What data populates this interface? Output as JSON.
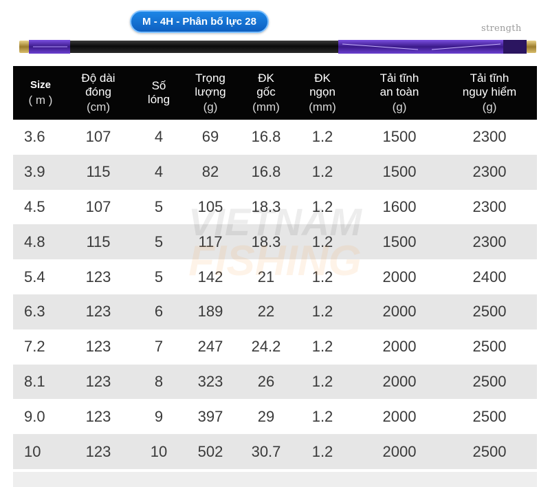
{
  "header": {
    "title": "M - 4H - Phân bố lực 28",
    "strength_label": "strength"
  },
  "table": {
    "columns": [
      {
        "lines": [
          "Size"
        ],
        "unit": "( m )",
        "bold": true
      },
      {
        "lines": [
          "Độ dài",
          "đóng"
        ],
        "unit": "(cm)"
      },
      {
        "lines": [
          "Số",
          "lóng"
        ],
        "unit": ""
      },
      {
        "lines": [
          "Trọng",
          "lượng"
        ],
        "unit": "(g)"
      },
      {
        "lines": [
          "ĐK",
          "gốc"
        ],
        "unit": "(mm)"
      },
      {
        "lines": [
          "ĐK",
          "ngọn"
        ],
        "unit": "(mm)"
      },
      {
        "lines": [
          "Tải tĩnh",
          "an toàn"
        ],
        "unit": "(g)"
      },
      {
        "lines": [
          "Tải tĩnh",
          "nguy hiểm"
        ],
        "unit": "(g)"
      }
    ],
    "rows": [
      [
        "3.6",
        "107",
        "4",
        "69",
        "16.8",
        "1.2",
        "1500",
        "2300"
      ],
      [
        "3.9",
        "115",
        "4",
        "82",
        "16.8",
        "1.2",
        "1500",
        "2300"
      ],
      [
        "4.5",
        "107",
        "5",
        "105",
        "18.3",
        "1.2",
        "1600",
        "2300"
      ],
      [
        "4.8",
        "115",
        "5",
        "117",
        "18.3",
        "1.2",
        "1500",
        "2300"
      ],
      [
        "5.4",
        "123",
        "5",
        "142",
        "21",
        "1.2",
        "2000",
        "2400"
      ],
      [
        "6.3",
        "123",
        "6",
        "189",
        "22",
        "1.2",
        "2000",
        "2500"
      ],
      [
        "7.2",
        "123",
        "7",
        "247",
        "24.2",
        "1.2",
        "2000",
        "2500"
      ],
      [
        "8.1",
        "123",
        "8",
        "323",
        "26",
        "1.2",
        "2000",
        "2500"
      ],
      [
        "9.0",
        "123",
        "9",
        "397",
        "29",
        "1.2",
        "2000",
        "2500"
      ],
      [
        "10",
        "123",
        "10",
        "502",
        "30.7",
        "1.2",
        "2000",
        "2500"
      ]
    ]
  },
  "watermark": {
    "line1": "VIETNAM",
    "line2": "FISHING"
  },
  "colors": {
    "title_pill": "#0e5fc0",
    "header_bg": "#050505",
    "row_alt": "#e6e6e6",
    "rod_accent": "#6a2fc0",
    "watermark_orange": "#f5a04a"
  }
}
